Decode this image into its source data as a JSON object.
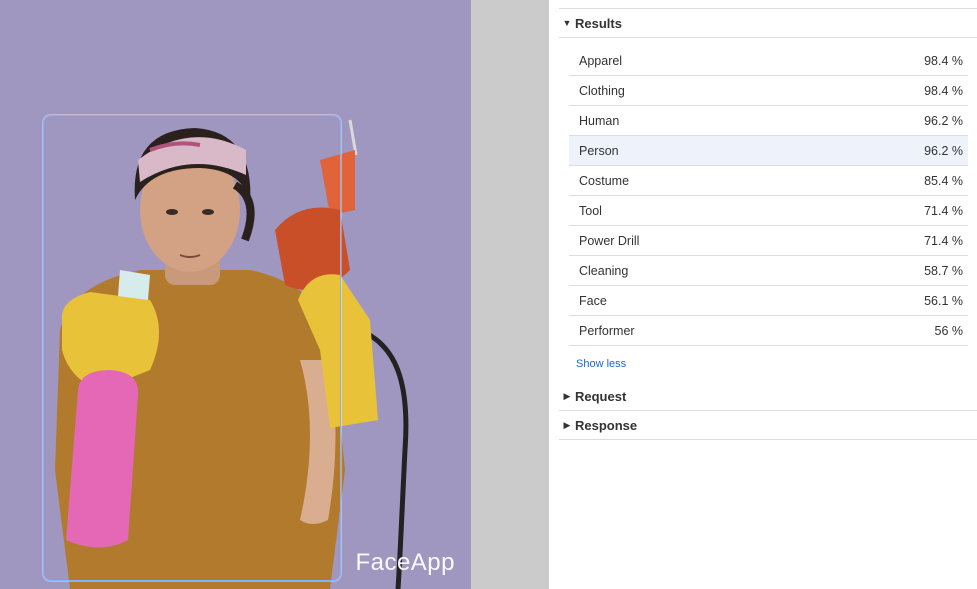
{
  "image": {
    "watermark": "FaceApp"
  },
  "results": {
    "title": "Results",
    "items": [
      {
        "label": "Apparel",
        "value": "98.4 %"
      },
      {
        "label": "Clothing",
        "value": "98.4 %"
      },
      {
        "label": "Human",
        "value": "96.2 %"
      },
      {
        "label": "Person",
        "value": "96.2 %"
      },
      {
        "label": "Costume",
        "value": "85.4 %"
      },
      {
        "label": "Tool",
        "value": "71.4 %"
      },
      {
        "label": "Power Drill",
        "value": "71.4 %"
      },
      {
        "label": "Cleaning",
        "value": "58.7 %"
      },
      {
        "label": "Face",
        "value": "56.1 %"
      },
      {
        "label": "Performer",
        "value": "56 %"
      }
    ],
    "highlighted_label": "Person",
    "show_less": "Show less"
  },
  "request": {
    "title": "Request"
  },
  "response": {
    "title": "Response"
  },
  "colors": {
    "image_background": "#a097c0",
    "gutter": "#cbcbcb",
    "link": "#1a66c8",
    "bounding_box": "#7fb3ff",
    "highlight_row": "#eef3fb"
  },
  "icons": {
    "expanded": "triangle-down-icon",
    "collapsed": "triangle-right-icon"
  }
}
